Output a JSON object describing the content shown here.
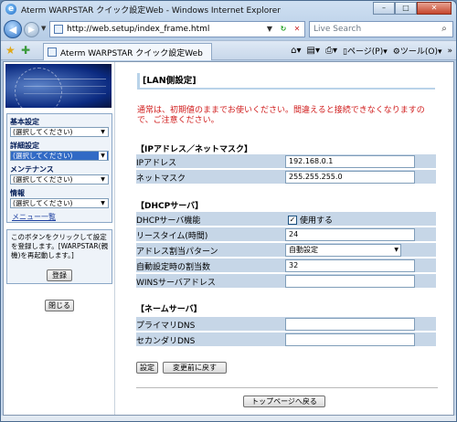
{
  "window": {
    "title": "Aterm WARPSTAR クイック設定Web - Windows Internet Explorer",
    "min_label": "–",
    "max_label": "□",
    "close_label": "✕"
  },
  "address": {
    "url": "http://web.setup/index_frame.html",
    "search_placeholder": "Live Search"
  },
  "tabs": [
    {
      "label": "Aterm WARPSTAR クイック設定Web"
    }
  ],
  "commandbar": {
    "page_label": "ページ(P)",
    "tools_label": "ツール(O)"
  },
  "sidebar": {
    "categories": [
      {
        "label": "基本設定",
        "select_value": "(選択してください)"
      },
      {
        "label": "詳細設定",
        "select_value": "(選択してください)"
      },
      {
        "label": "メンテナンス",
        "select_value": "(選択してください)"
      },
      {
        "label": "情報",
        "select_value": "(選択してください)"
      }
    ],
    "menu_list_link": "メニュー一覧",
    "register_text": "このボタンをクリックして設定を登録します。[WARPSTAR(親機)を再起動します。]",
    "register_button": "登録",
    "close_button": "閉じる"
  },
  "main": {
    "page_title": "[LAN側設定]",
    "warning": "通常は、初期値のままでお使いください。間違えると接続できなくなりますので、ご注意ください。",
    "ip_section": {
      "title": "【IPアドレス／ネットマスク】",
      "rows": [
        {
          "label": "IPアドレス",
          "value": "192.168.0.1"
        },
        {
          "label": "ネットマスク",
          "value": "255.255.255.0"
        }
      ]
    },
    "dhcp_section": {
      "title": "【DHCPサーバ】",
      "function_label": "DHCPサーバ機能",
      "function_checkbox_label": "使用する",
      "function_checked": true,
      "lease_label": "リースタイム(時間)",
      "lease_value": "24",
      "pattern_label": "アドレス割当パターン",
      "pattern_value": "自動設定",
      "count_label": "自動設定時の割当数",
      "count_value": "32",
      "wins_label": "WINSサーバアドレス",
      "wins_value": ""
    },
    "dns_section": {
      "title": "【ネームサーバ】",
      "rows": [
        {
          "label": "プライマリDNS",
          "value": ""
        },
        {
          "label": "セカンダリDNS",
          "value": ""
        }
      ]
    },
    "set_button": "設定",
    "revert_button": "変更前に戻す",
    "top_button": "トップページへ戻る"
  }
}
